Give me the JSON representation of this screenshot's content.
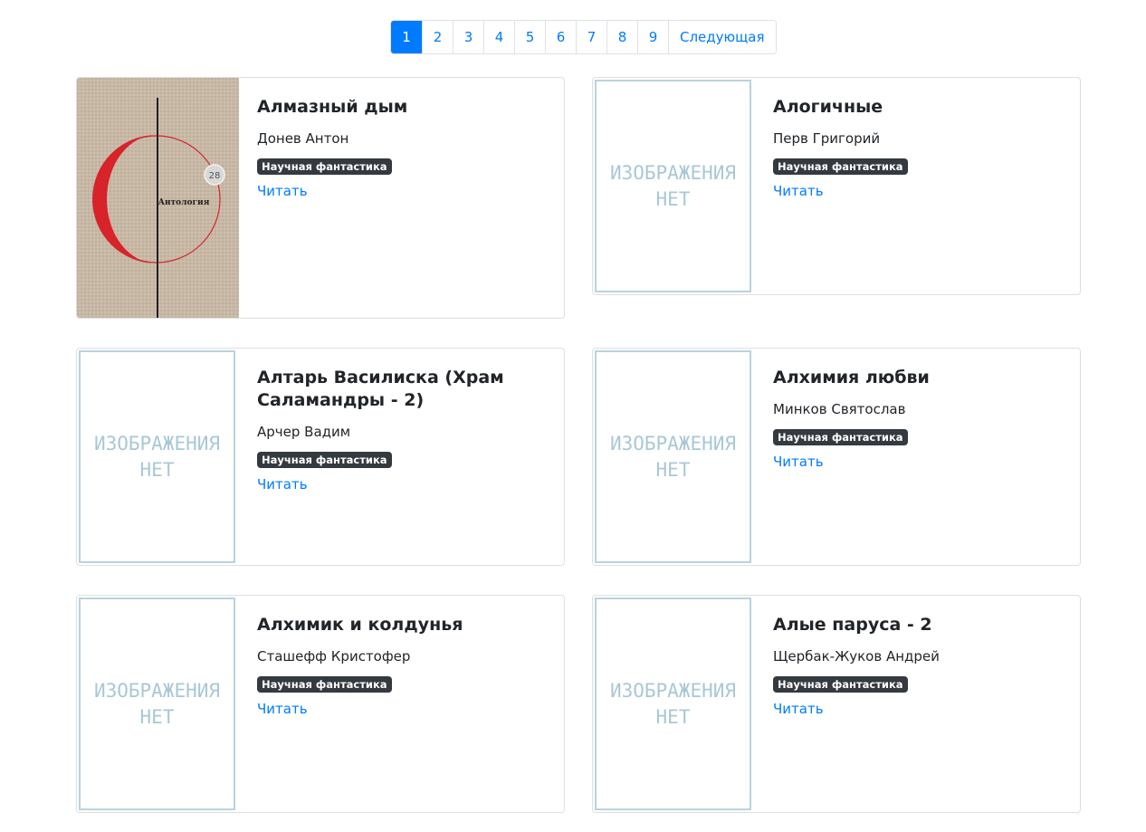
{
  "pagination": {
    "pages": [
      "1",
      "2",
      "3",
      "4",
      "5",
      "6",
      "7",
      "8",
      "9"
    ],
    "active": "1",
    "next_label": "Следующая"
  },
  "no_image": {
    "line1": "ИЗОБРАЖЕНИЯ",
    "line2": "НЕТ"
  },
  "cover_text": {
    "title": "Антология",
    "badge": "28"
  },
  "books": [
    {
      "title": "Алмазный дым",
      "author": "Донев Антон",
      "genre": "Научная фантастика",
      "read": "Читать"
    },
    {
      "title": "Алогичные",
      "author": "Перв Григорий",
      "genre": "Научная фантастика",
      "read": "Читать"
    },
    {
      "title": "Алтарь Василиска (Храм Саламандры - 2)",
      "author": "Арчер Вадим",
      "genre": "Научная фантастика",
      "read": "Читать"
    },
    {
      "title": "Алхимия любви",
      "author": "Минков Святослав",
      "genre": "Научная фантастика",
      "read": "Читать"
    },
    {
      "title": "Алхимик и колдунья",
      "author": "Сташефф Кристофер",
      "genre": "Научная фантастика",
      "read": "Читать"
    },
    {
      "title": "Алые паруса - 2",
      "author": "Щербак-Жуков Андрей",
      "genre": "Научная фантастика",
      "read": "Читать"
    }
  ],
  "colors": {
    "link": "#007bff",
    "badge": "#343a40",
    "placeholder": "#a9c8d6"
  }
}
